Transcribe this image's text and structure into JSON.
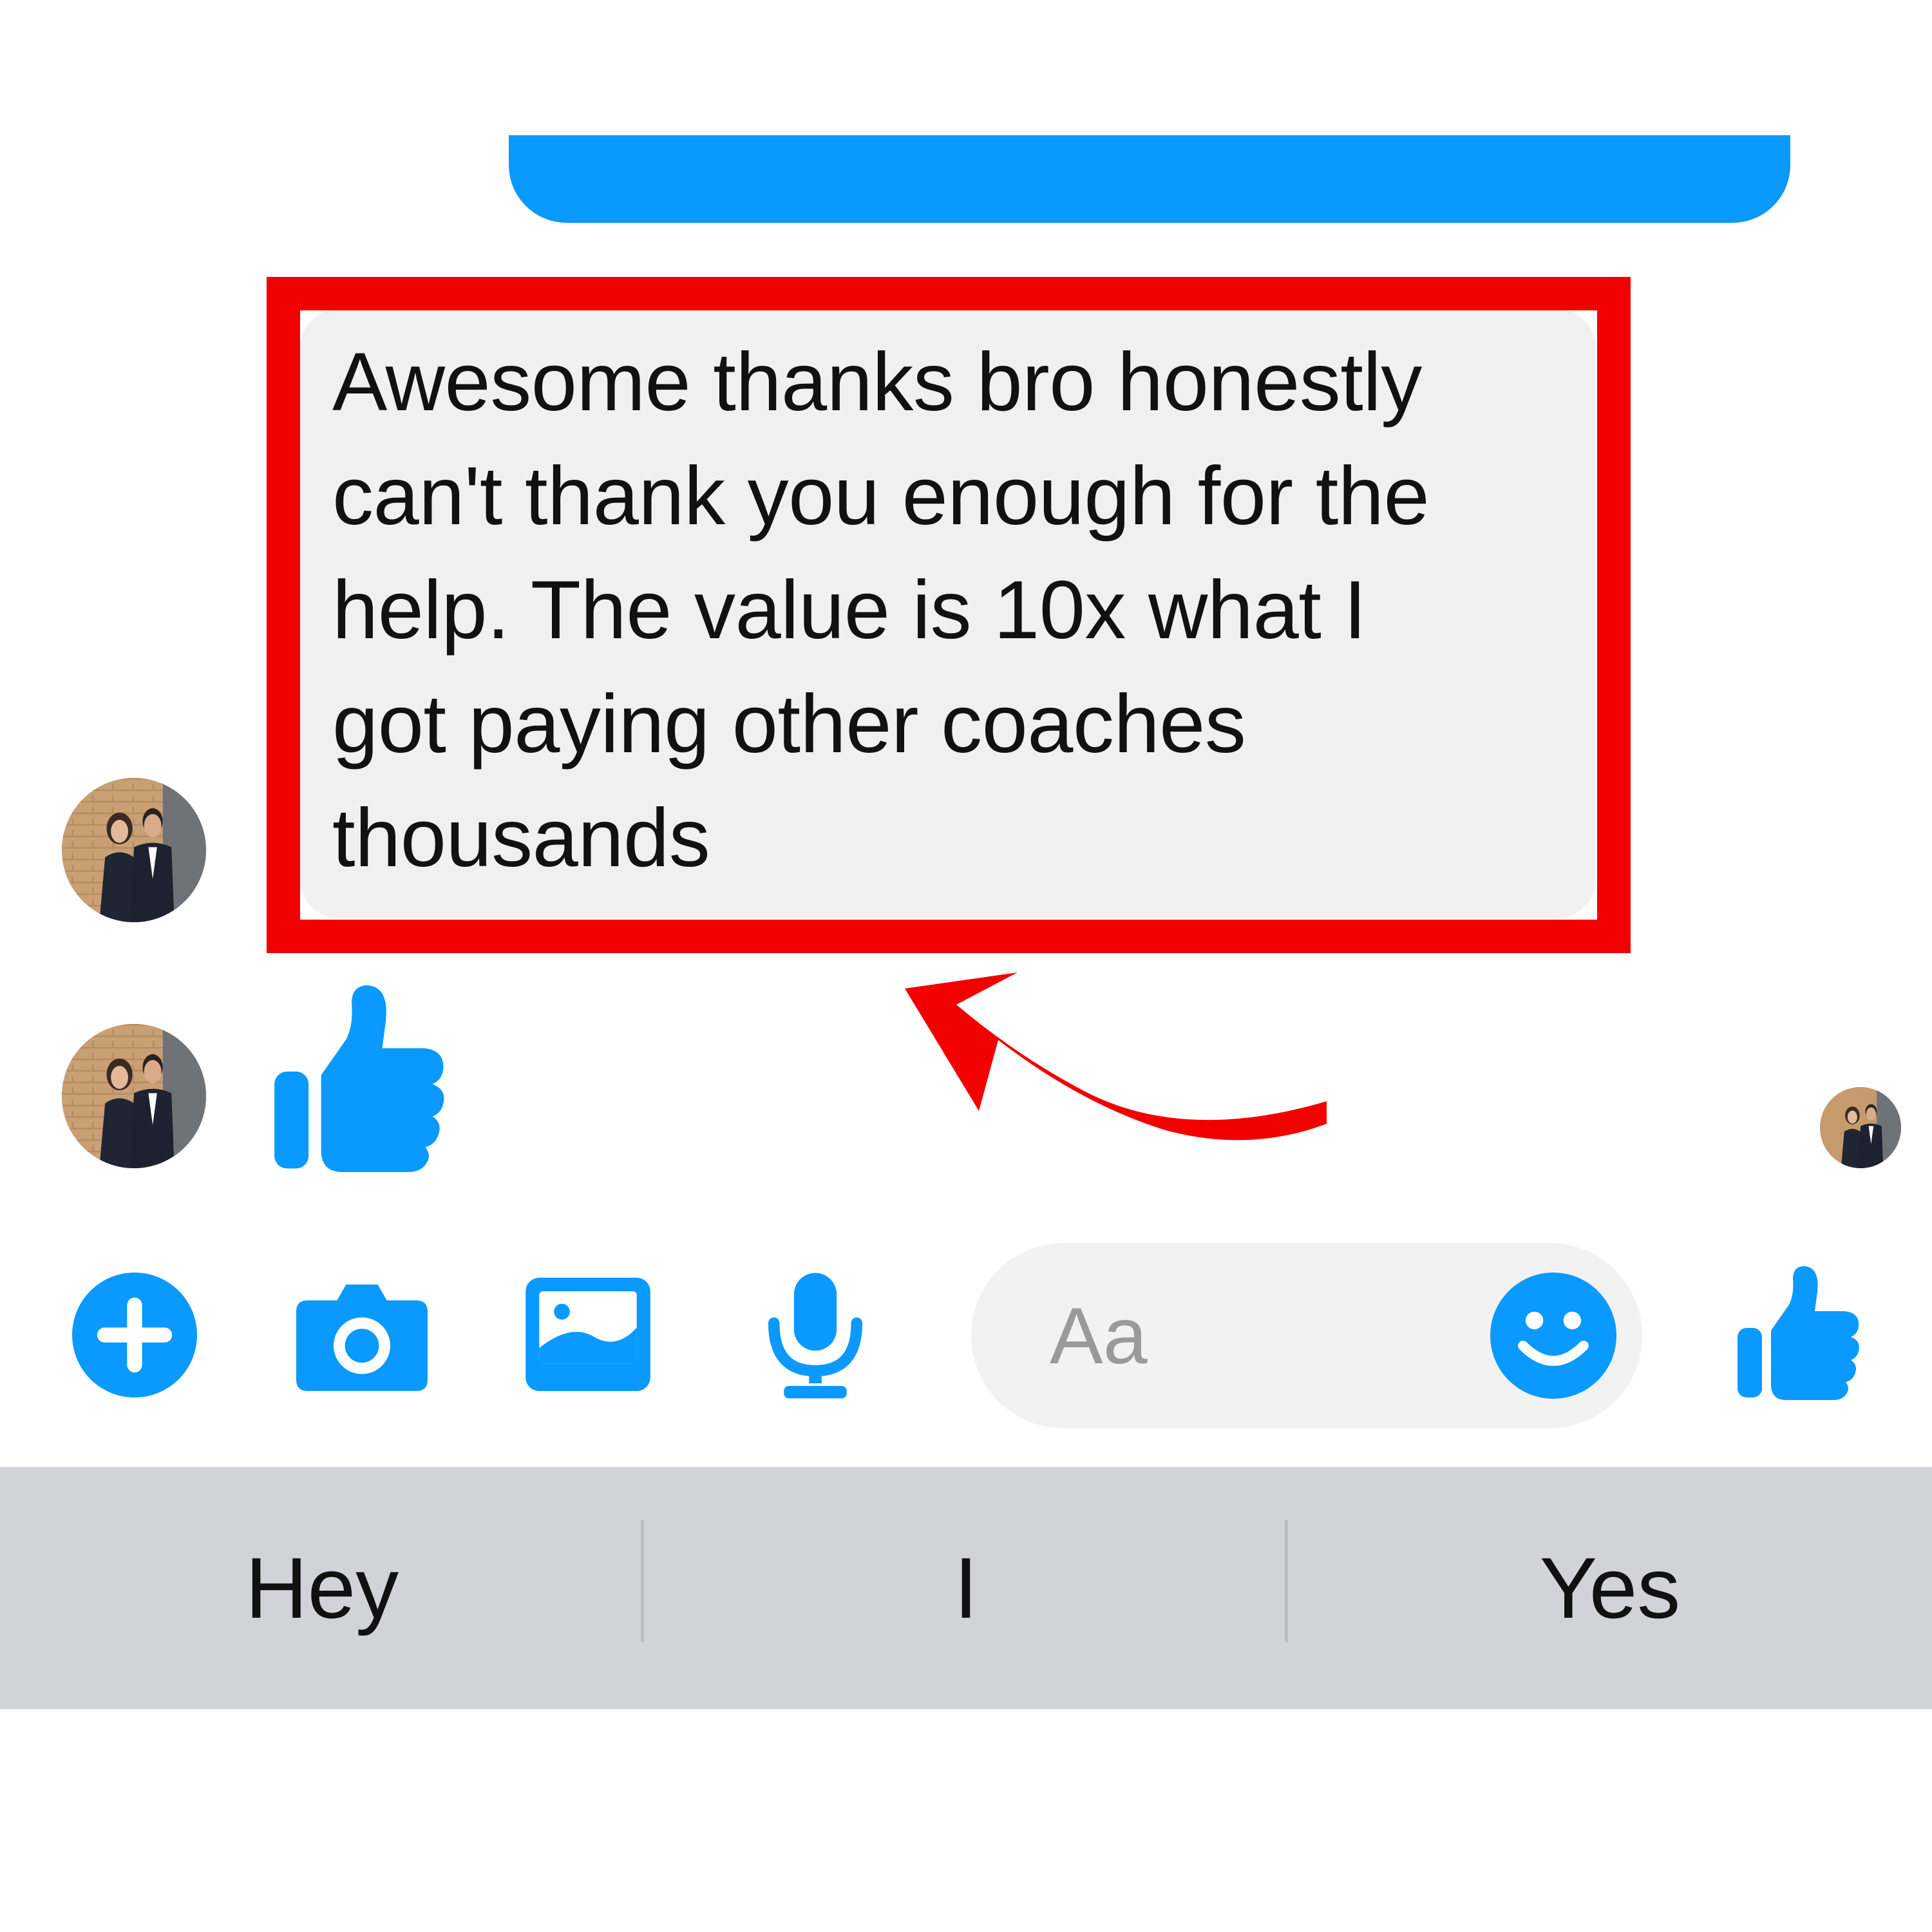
{
  "conversation": {
    "received_message": "Awesome thanks bro honestly\ncan't thank you enough for the\nhelp. The value is 10x what I\ngot paying other coaches\nthousands",
    "received_like": "thumbs-up-icon",
    "seen_avatar": "read-receipt-avatar"
  },
  "composer": {
    "placeholder": "Aa",
    "value": ""
  },
  "toolbar": {
    "icons": [
      "plus-icon",
      "camera-icon",
      "gallery-icon",
      "microphone-icon",
      "emoji-icon",
      "thumbs-up-icon"
    ]
  },
  "suggestions": {
    "items": [
      "Hey",
      "I",
      "Yes"
    ]
  },
  "colors": {
    "brand_blue": "#0a99ff",
    "highlight_red": "#f20000",
    "bubble_gray": "#f0f0f0",
    "suggest_bar": "#d2d3d8"
  }
}
